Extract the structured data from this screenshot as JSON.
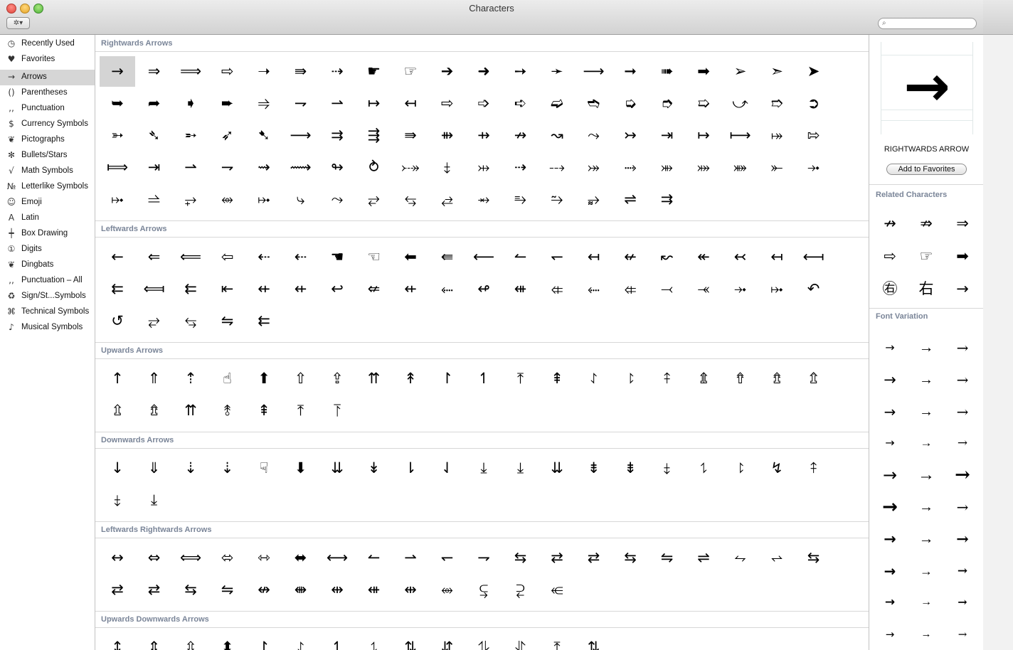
{
  "window": {
    "title": "Characters"
  },
  "toolbar": {
    "gear_label": "✲▾",
    "search_placeholder": ""
  },
  "sidebar": {
    "items": [
      {
        "icon": "◷",
        "label": "Recently Used"
      },
      {
        "icon": "♥",
        "label": "Favorites"
      },
      {
        "icon": "→",
        "label": "Arrows"
      },
      {
        "icon": "()",
        "label": "Parentheses"
      },
      {
        "icon": "‚‚",
        "label": "Punctuation"
      },
      {
        "icon": "$",
        "label": "Currency Symbols"
      },
      {
        "icon": "❦",
        "label": "Pictographs"
      },
      {
        "icon": "✻",
        "label": "Bullets/Stars"
      },
      {
        "icon": "√",
        "label": "Math Symbols"
      },
      {
        "icon": "№",
        "label": "Letterlike Symbols"
      },
      {
        "icon": "☺",
        "label": "Emoji"
      },
      {
        "icon": "A",
        "label": "Latin"
      },
      {
        "icon": "┿",
        "label": "Box Drawing"
      },
      {
        "icon": "①",
        "label": "Digits"
      },
      {
        "icon": "❦",
        "label": "Dingbats"
      },
      {
        "icon": "‚‚",
        "label": "Punctuation – All"
      },
      {
        "icon": "♻",
        "label": "Sign/St...Symbols"
      },
      {
        "icon": "⌘",
        "label": "Technical Symbols"
      },
      {
        "icon": "♪",
        "label": "Musical Symbols"
      }
    ],
    "selected_index": 2
  },
  "sections": [
    {
      "title": "Rightwards Arrows",
      "chars": [
        "→",
        "⇒",
        "⟹",
        "⇨",
        "➝",
        "⇛",
        "⇢",
        "☛",
        "☞",
        "➔",
        "➜",
        "➙",
        "➛",
        "⟶",
        "➞",
        "➠",
        "➡",
        "➢",
        "➣",
        "➤",
        "➥",
        "➦",
        "➧",
        "➨",
        "⥤",
        "⇁",
        "⇀",
        "↦",
        "↤",
        "⇨",
        "➩",
        "➪",
        "➫",
        "➬",
        "➭",
        "➮",
        "➯",
        "⤻",
        "➱",
        "➲",
        "➳",
        "➴",
        "➵",
        "➶",
        "➷",
        "⟶",
        "⇉",
        "⇶",
        "⇛",
        "⇻",
        "⇸",
        "↛",
        "↝",
        "⤳",
        "↣",
        "⇥",
        "↦",
        "⟼",
        "⤅",
        "⇰",
        "⟾",
        "⇥",
        "⇀",
        "⇁",
        "⇝",
        "⟿",
        "↬",
        "⥁",
        "⤐",
        "⤈",
        "⤔",
        "⇢",
        "⤏",
        "⤖",
        "⤑",
        "⤕",
        "⤗",
        "⤘",
        "⤜",
        "⤞",
        "⤠",
        "⥬",
        "⥅",
        "⥈",
        "⤠",
        "⤷",
        "⤳",
        "⥂",
        "⥃",
        "⥄",
        "⥇",
        "⥱",
        "⥲",
        "⥵",
        "⇌",
        "⇉"
      ],
      "selected_index": 0
    },
    {
      "title": "Leftwards Arrows",
      "chars": [
        "←",
        "⇐",
        "⟸",
        "⇦",
        "⇠",
        "⇠",
        "☚",
        "☜",
        "⬅",
        "⇚",
        "⟵",
        "↼",
        "↽",
        "↤",
        "↚",
        "↜",
        "↞",
        "↢",
        "↤",
        "⟻",
        "⇇",
        "⟽",
        "⇇",
        "⇤",
        "⇷",
        "⇷",
        "↩",
        "⇍",
        "⇷",
        "⬸",
        "↫",
        "⇺",
        "⤂",
        "⬸",
        "⤂",
        "⤙",
        "⤛",
        "⤞",
        "⤠",
        "↶",
        "↺",
        "⥂",
        "⥃",
        "⇋",
        "⇇"
      ]
    },
    {
      "title": "Upwards Arrows",
      "chars": [
        "↑",
        "⇑",
        "⇡",
        "☝",
        "⬆",
        "⇧",
        "⇪",
        "⇈",
        "↟",
        "↾",
        "↿",
        "⤒",
        "⇞",
        "⥌",
        "⥏",
        "⤉",
        "⇭",
        "⇮",
        "⇯",
        "⇬",
        "⇫",
        "⇯",
        "⇈",
        "⥉",
        "⇞",
        "⤒",
        "⥔"
      ]
    },
    {
      "title": "Downwards Arrows",
      "chars": [
        "↓",
        "⇓",
        "⇣",
        "⇣",
        "☟",
        "⬇",
        "⇊",
        "↡",
        "⇂",
        "⇃",
        "⤓",
        "⤓",
        "⇊",
        "⇟",
        "⇟",
        "⤈",
        "⥍",
        "⥏",
        "↯",
        "⤉",
        "⤈",
        "⤓"
      ]
    },
    {
      "title": "Leftwards Rightwards Arrows",
      "chars": [
        "↔",
        "⇔",
        "⟺",
        "⬄",
        "⇿",
        "⬌",
        "⟷",
        "↼",
        "⇀",
        "↽",
        "⇁",
        "⇆",
        "⇄",
        "⇄",
        "⇆",
        "⇋",
        "⇌",
        "⥊",
        "⥋",
        "⇆",
        "⇄",
        "⇄",
        "⇆",
        "⇋",
        "↮",
        "⇼",
        "⇹",
        "⇺",
        "⇹",
        "⥈",
        "⥹",
        "⥻",
        "⥺"
      ]
    },
    {
      "title": "Upwards Downwards Arrows",
      "chars": [
        "↕",
        "⇕",
        "⇳",
        "⬍",
        "↾",
        "⥌",
        "↿",
        "⥍",
        "⇅",
        "⇵",
        "⥮",
        "⥯",
        "⤒",
        "⇅"
      ]
    }
  ],
  "detail": {
    "glyph": "→",
    "name": "RIGHTWARDS ARROW",
    "add_button": "Add to Favorites",
    "related_header": "Related Characters",
    "related": [
      "↛",
      "⇏",
      "⇒",
      "⇨",
      "☞",
      "➡",
      "㊨",
      "右",
      "→"
    ],
    "font_variation_header": "Font Variation",
    "variations": [
      "→",
      "→",
      "→",
      "→",
      "→",
      "→",
      "→",
      "→",
      "→",
      "→",
      "→",
      "→",
      "→",
      "→",
      "→",
      "→",
      "→",
      "→",
      "→",
      "→",
      "→",
      "→",
      "→",
      "→",
      "→",
      "→",
      "→",
      "→",
      "→",
      "→"
    ]
  }
}
